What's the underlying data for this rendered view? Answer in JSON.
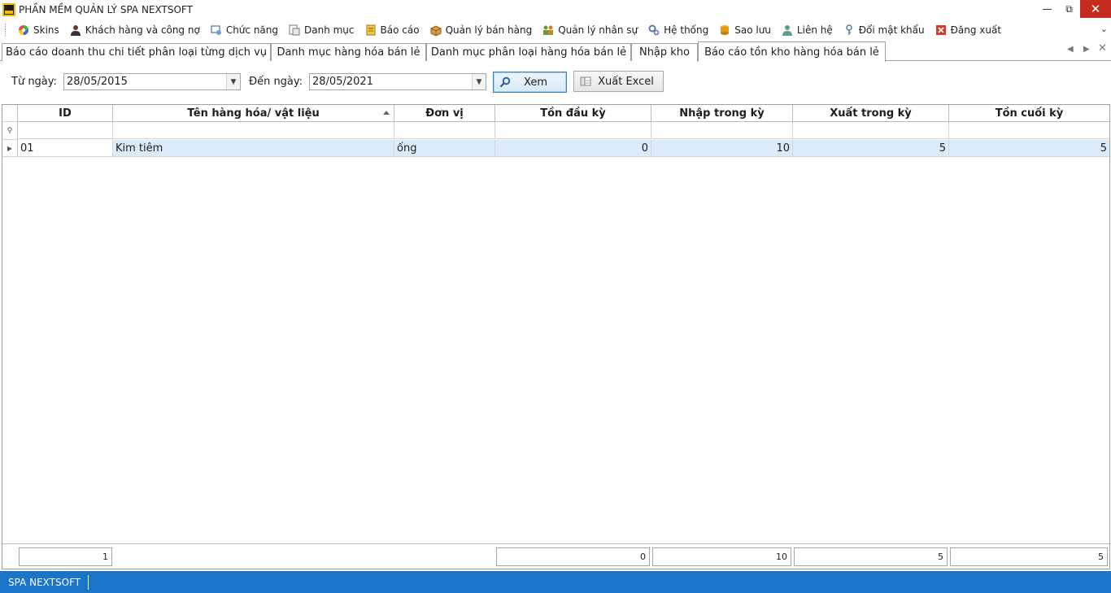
{
  "window": {
    "title": "PHẦN MỀM QUẢN LÝ SPA NEXTSOFT"
  },
  "menu": {
    "items": [
      {
        "label": "Skins",
        "icon": "palette-icon"
      },
      {
        "label": "Khách hàng và công nợ",
        "icon": "customer-icon"
      },
      {
        "label": "Chức năng",
        "icon": "function-icon"
      },
      {
        "label": "Danh mục",
        "icon": "catalog-icon"
      },
      {
        "label": "Báo cáo",
        "icon": "report-icon"
      },
      {
        "label": "Quản lý bán hàng",
        "icon": "sales-box-icon"
      },
      {
        "label": "Quản lý nhân sự",
        "icon": "staff-icon"
      },
      {
        "label": "Hệ thống",
        "icon": "gears-icon"
      },
      {
        "label": "Sao lưu",
        "icon": "database-icon"
      },
      {
        "label": "Liên hệ",
        "icon": "contact-icon"
      },
      {
        "label": "Đổi mật khẩu",
        "icon": "key-icon"
      },
      {
        "label": "Đăng xuất",
        "icon": "logout-icon"
      }
    ]
  },
  "tabs": [
    {
      "label": "Báo cáo doanh thu chi tiết phân loại từng dịch vụ",
      "active": false
    },
    {
      "label": "Danh mục hàng hóa bán lẻ",
      "active": false
    },
    {
      "label": "Danh mục phân loại hàng hóa bán lẻ",
      "active": false
    },
    {
      "label": "Nhập kho",
      "active": false
    },
    {
      "label": "Báo cáo tồn kho hàng hóa bán lẻ",
      "active": true
    }
  ],
  "filter": {
    "from_label": "Từ ngày:",
    "from_value": "28/05/2015",
    "to_label": "Đến ngày:",
    "to_value": "28/05/2021",
    "view_button": "Xem",
    "export_button": "Xuất Excel"
  },
  "grid": {
    "columns": [
      "ID",
      "Tên hàng hóa/ vật liệu",
      "Đơn vị",
      "Tồn đầu kỳ",
      "Nhập trong kỳ",
      "Xuất trong kỳ",
      "Tồn cuối kỳ"
    ],
    "sorted_column": "Tên hàng hóa/ vật liệu",
    "rows": [
      {
        "id": "01",
        "name": "Kim tiêm",
        "unit": "ống",
        "opening": "0",
        "imported": "10",
        "exported": "5",
        "closing": "5"
      }
    ],
    "summary": {
      "count": "1",
      "opening": "0",
      "imported": "10",
      "exported": "5",
      "closing": "5"
    }
  },
  "status": {
    "text": "SPA NEXTSOFT"
  },
  "colors": {
    "status_bar": "#1a74c8",
    "selected_row": "#dcebfa",
    "close_button": "#c42b1c"
  }
}
